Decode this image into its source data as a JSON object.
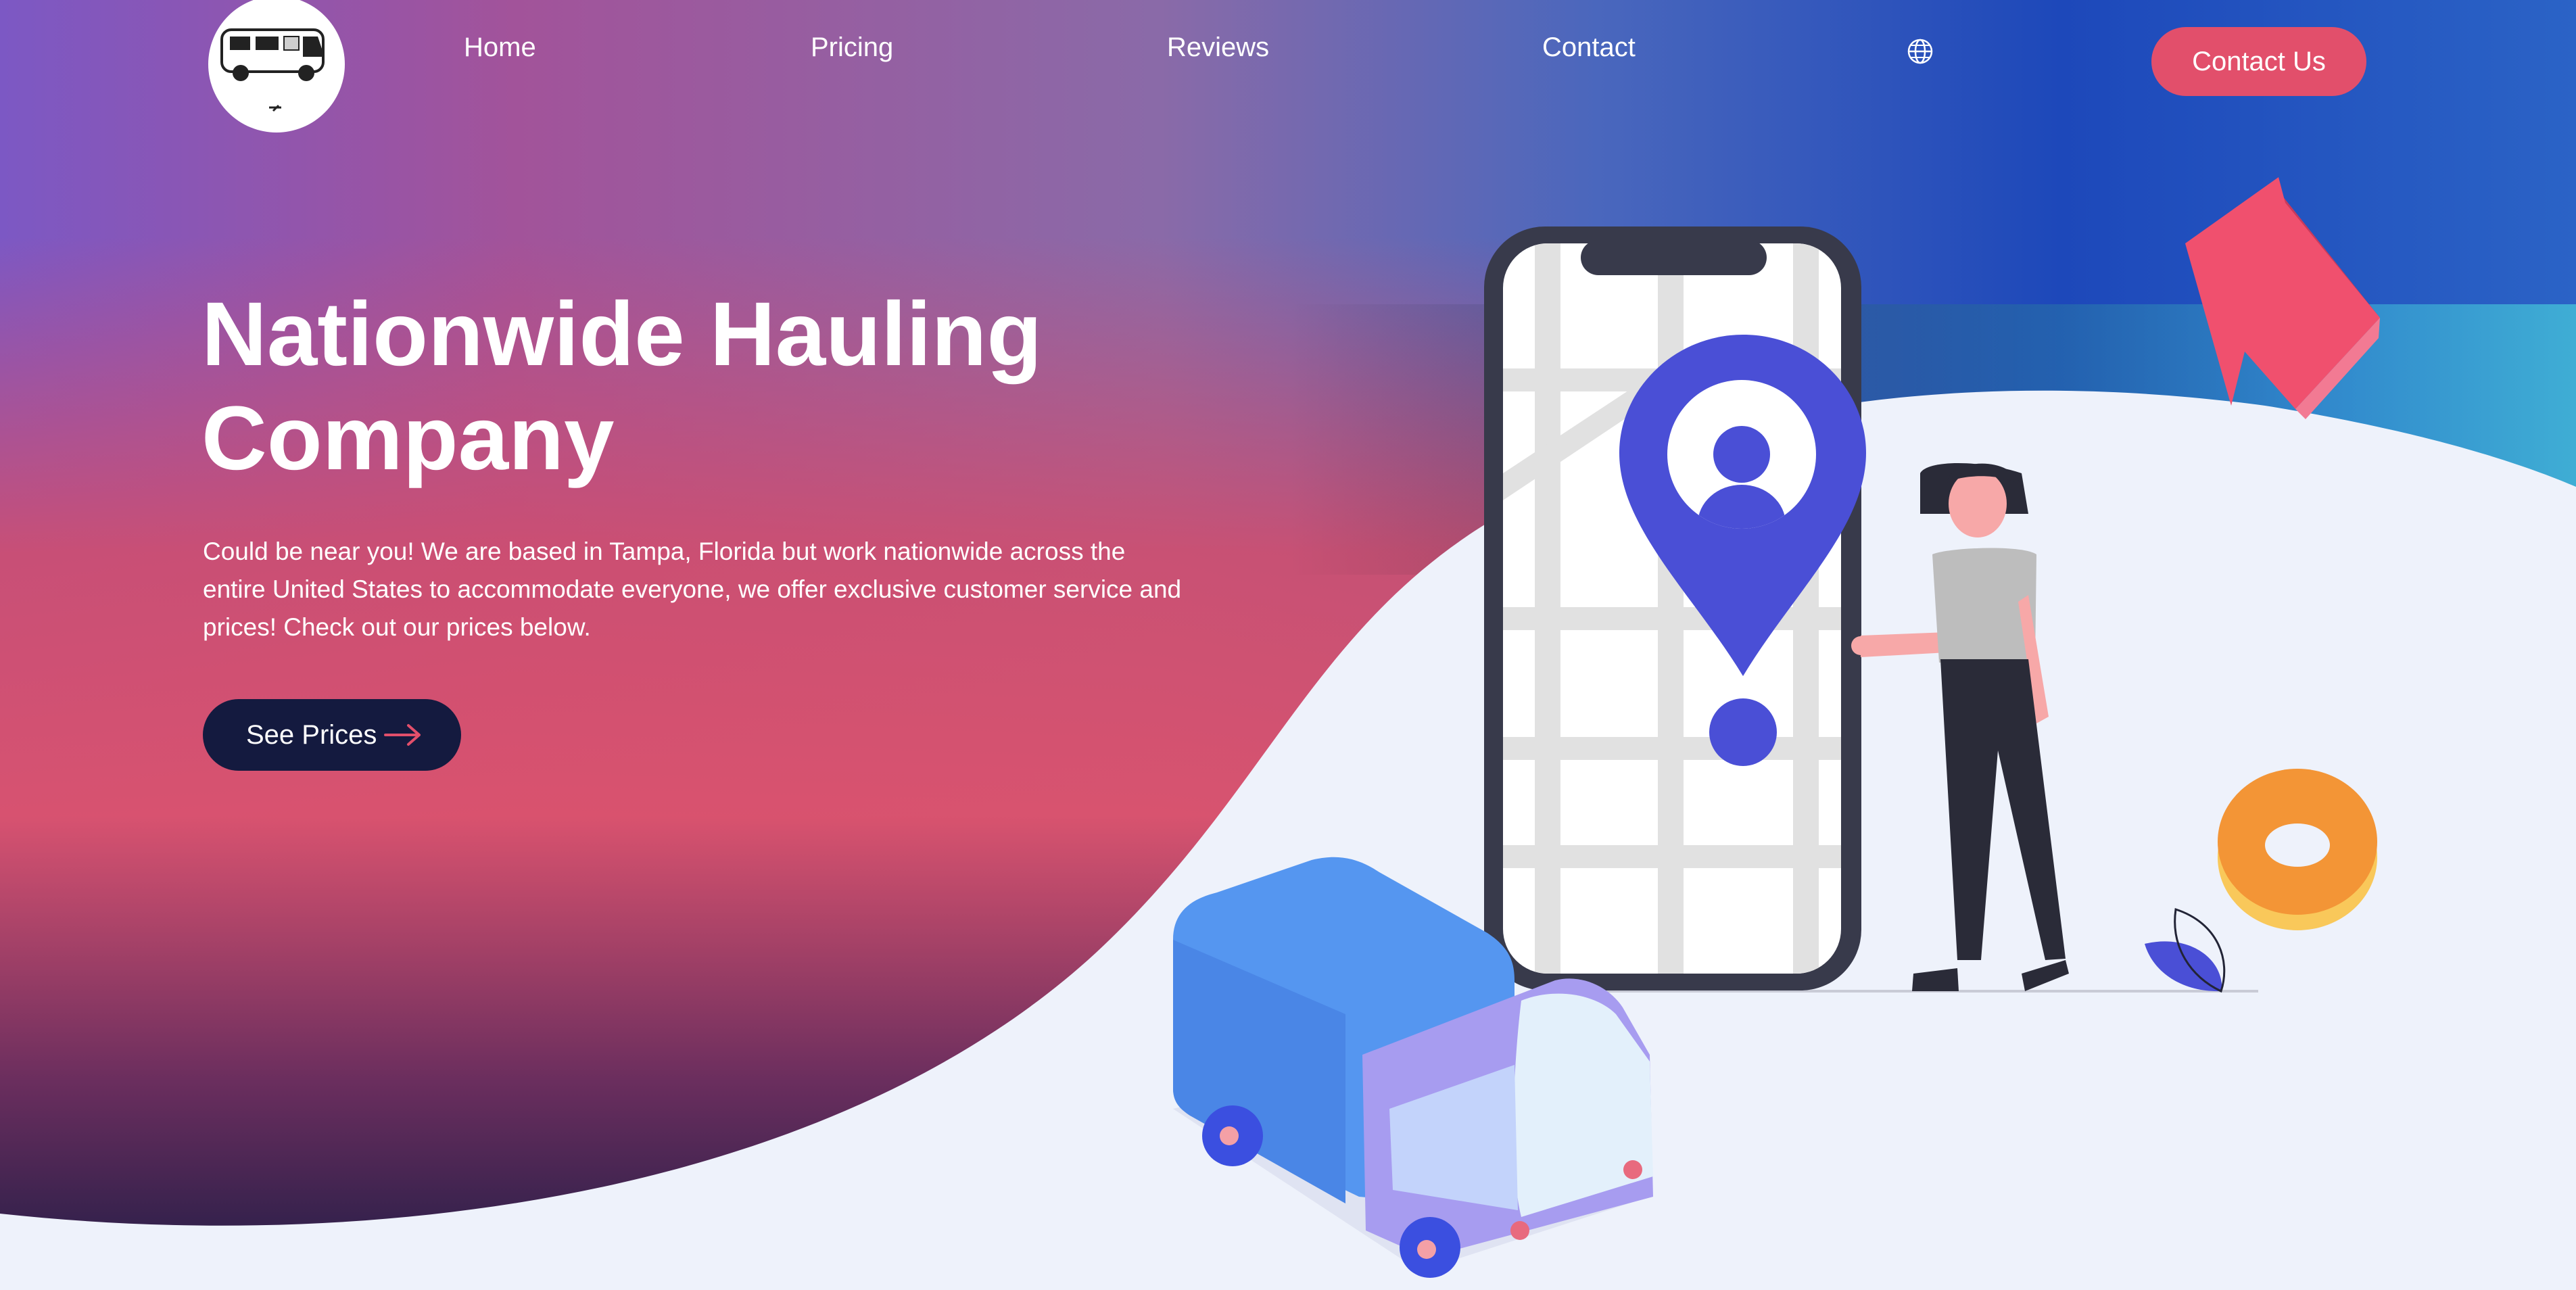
{
  "nav": {
    "links": [
      "Home",
      "Pricing",
      "Reviews",
      "Contact"
    ],
    "language_icon": "globe-icon",
    "contact_button": "Contact Us",
    "logo_icon": "van-logo-icon"
  },
  "hero": {
    "title_line1": "Nationwide Hauling",
    "title_line2": "Company",
    "description": "Could be near you! We are based in Tampa, Florida but work nationwide across the entire United States to accommodate everyone, we offer exclusive customer service and prices! Check out our prices below.",
    "cta_label": "See Prices",
    "cta_icon": "arrow-right-icon"
  },
  "colors": {
    "accent": "#e24f6b",
    "dark_button": "#141a3f",
    "pin_blue": "#4a4fd6",
    "background_light": "#eef2fb"
  }
}
